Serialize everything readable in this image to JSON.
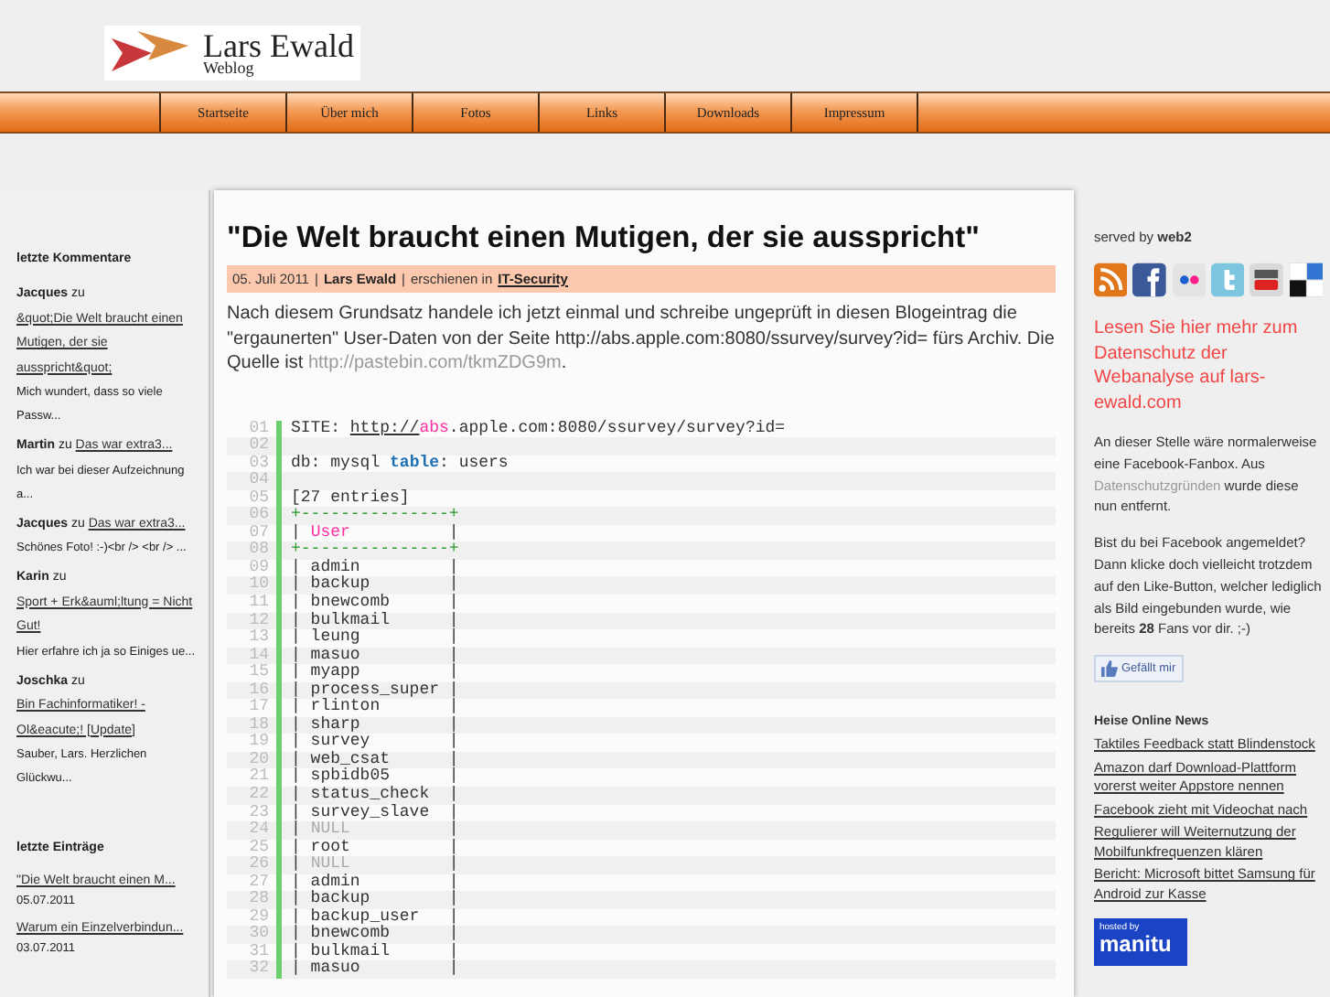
{
  "header": {
    "title": "Lars Ewald",
    "subtitle": "Weblog"
  },
  "nav": [
    "Startseite",
    "Über mich",
    "Fotos",
    "Links",
    "Downloads",
    "Impressum"
  ],
  "left_sidebar": {
    "comments_heading": "letzte Kommentare",
    "comments": [
      {
        "author": "Jacques",
        "connector": "zu",
        "link": "&quot;Die Welt braucht einen Mutigen, der sie ausspricht&quot;",
        "excerpt": "Mich wundert, dass so viele Passw..."
      },
      {
        "author": "Martin",
        "connector": "zu",
        "link": "Das war extra3...",
        "excerpt": "Ich war bei dieser Aufzeichnung a..."
      },
      {
        "author": "Jacques",
        "connector": "zu",
        "link": "Das war extra3...",
        "excerpt": "Schönes Foto! :-)<br /> <br /> ..."
      },
      {
        "author": "Karin",
        "connector": "zu",
        "link": "Sport + Erk&auml;ltung = Nicht Gut!",
        "excerpt": "Hier erfahre ich ja so Einiges ue..."
      },
      {
        "author": "Joschka",
        "connector": "zu",
        "link": "Bin Fachinformatiker! - Ol&eacute;! [Update]",
        "excerpt": "Sauber, Lars. Herzlichen Glückwu..."
      }
    ],
    "entries_heading": "letzte Einträge",
    "entries": [
      {
        "link": "\"Die Welt braucht einen M...",
        "date": "05.07.2011"
      },
      {
        "link": "Warum ein Einzelverbindun...",
        "date": "03.07.2011"
      }
    ]
  },
  "post": {
    "title": "\"Die Welt braucht einen Mutigen, der sie ausspricht\"",
    "meta": {
      "date": "05. Juli 2011",
      "separator_1": "|",
      "author": "Lars Ewald",
      "separator_2": "|",
      "published_in": "erschienen in",
      "category": "IT-Security"
    },
    "body": "Nach diesem Grundsatz handele ich jetzt einmal und schreibe ungeprüft in diesen Blogeintrag die \"ergaunerten\" User-Daten von der Seite http://abs.apple.com:8080/ssurvey/survey?id= fürs Archiv. Die Quelle ist",
    "body_link": "http://pastebin.com/tkmZDG9m",
    "body_end": ".",
    "code": [
      {
        "number": "01",
        "tokens": [
          {
            "kind": "plain",
            "text": "SITE: "
          },
          {
            "kind": "link",
            "text": "http://"
          },
          {
            "kind": "string",
            "text": "abs"
          },
          {
            "kind": "plain",
            "text": ".apple.com:8080/ssurvey/survey?id="
          }
        ]
      },
      {
        "number": "02"
      },
      {
        "number": "03",
        "tokens": [
          {
            "kind": "plain",
            "text": "db: mysql "
          },
          {
            "kind": "keyword",
            "text": "table"
          },
          {
            "kind": "plain",
            "text": ": users"
          }
        ]
      },
      {
        "number": "04"
      },
      {
        "number": "05",
        "tokens": [
          {
            "kind": "plain",
            "text": "[27 entries]"
          }
        ]
      },
      {
        "number": "06",
        "tokens": [
          {
            "kind": "border",
            "text": "+---------------+"
          }
        ]
      },
      {
        "number": "07",
        "tokens": [
          {
            "kind": "plain",
            "text": "| "
          },
          {
            "kind": "string",
            "text": "User"
          },
          {
            "kind": "plain",
            "text": "          |"
          }
        ]
      },
      {
        "number": "08",
        "tokens": [
          {
            "kind": "border",
            "text": "+---------------+"
          }
        ]
      },
      {
        "number": "09",
        "tokens": [
          {
            "kind": "plain",
            "text": "| admin         |"
          }
        ]
      },
      {
        "number": "10",
        "tokens": [
          {
            "kind": "plain",
            "text": "| backup        |"
          }
        ]
      },
      {
        "number": "11",
        "tokens": [
          {
            "kind": "plain",
            "text": "| bnewcomb      |"
          }
        ]
      },
      {
        "number": "12",
        "tokens": [
          {
            "kind": "plain",
            "text": "| bulkmail      |"
          }
        ]
      },
      {
        "number": "13",
        "tokens": [
          {
            "kind": "plain",
            "text": "| leung         |"
          }
        ]
      },
      {
        "number": "14",
        "tokens": [
          {
            "kind": "plain",
            "text": "| masuo         |"
          }
        ]
      },
      {
        "number": "15",
        "tokens": [
          {
            "kind": "plain",
            "text": "| myapp         |"
          }
        ]
      },
      {
        "number": "16",
        "tokens": [
          {
            "kind": "plain",
            "text": "| process_super |"
          }
        ]
      },
      {
        "number": "17",
        "tokens": [
          {
            "kind": "plain",
            "text": "| rlinton       |"
          }
        ]
      },
      {
        "number": "18",
        "tokens": [
          {
            "kind": "plain",
            "text": "| sharp         |"
          }
        ]
      },
      {
        "number": "19",
        "tokens": [
          {
            "kind": "plain",
            "text": "| survey        |"
          }
        ]
      },
      {
        "number": "20",
        "tokens": [
          {
            "kind": "plain",
            "text": "| web_csat      |"
          }
        ]
      },
      {
        "number": "21",
        "tokens": [
          {
            "kind": "plain",
            "text": "| spbidb05      |"
          }
        ]
      },
      {
        "number": "22",
        "tokens": [
          {
            "kind": "plain",
            "text": "| status_check  |"
          }
        ]
      },
      {
        "number": "23",
        "tokens": [
          {
            "kind": "plain",
            "text": "| survey_slave  |"
          }
        ]
      },
      {
        "number": "24",
        "tokens": [
          {
            "kind": "plain",
            "text": "| "
          },
          {
            "kind": "null",
            "text": "NULL"
          },
          {
            "kind": "plain",
            "text": "          |"
          }
        ]
      },
      {
        "number": "25",
        "tokens": [
          {
            "kind": "plain",
            "text": "| root          |"
          }
        ]
      },
      {
        "number": "26",
        "tokens": [
          {
            "kind": "plain",
            "text": "| "
          },
          {
            "kind": "null",
            "text": "NULL"
          },
          {
            "kind": "plain",
            "text": "          |"
          }
        ]
      },
      {
        "number": "27",
        "tokens": [
          {
            "kind": "plain",
            "text": "| admin         |"
          }
        ]
      },
      {
        "number": "28",
        "tokens": [
          {
            "kind": "plain",
            "text": "| backup        |"
          }
        ]
      },
      {
        "number": "29",
        "tokens": [
          {
            "kind": "plain",
            "text": "| backup_user   |"
          }
        ]
      },
      {
        "number": "30",
        "tokens": [
          {
            "kind": "plain",
            "text": "| bnewcomb      |"
          }
        ]
      },
      {
        "number": "31",
        "tokens": [
          {
            "kind": "plain",
            "text": "| bulkmail      |"
          }
        ]
      },
      {
        "number": "32",
        "tokens": [
          {
            "kind": "plain",
            "text": "| masuo         |"
          }
        ]
      }
    ]
  },
  "right_sidebar": {
    "served_by": "served by **web2**",
    "privacy_link": "Lesen Sie hier mehr zum Datenschutz der Webanalyse auf lars-ewald.com",
    "fanbox_before": "An dieser Stelle wäre normalerweise eine Facebook-Fanbox. Aus",
    "fanbox_link": "Datenschutzgründen",
    "fanbox_after": "wurde diese nun entfernt.",
    "like_text": "Bist du bei Facebook angemeldet? Dann klicke doch vielleicht trotzdem auf den Like-Button, welcher lediglich als Bild eingebunden wurde, wie bereits **28** Fans vor dir. ;-)",
    "like_button": "Gefällt mir",
    "news_heading": "Heise Online News",
    "news": [
      "Taktiles Feedback statt Blindenstock",
      "Amazon darf Download-Plattform vorerst weiter Appstore nennen",
      "Facebook zieht mit Videochat nach",
      "Regulierer will Weiternutzung der Mobilfunkfrequenzen klären",
      "Bericht: Microsoft bittet Samsung für Android zur Kasse"
    ],
    "hosted_by": "hosted by",
    "host": "manitu"
  }
}
